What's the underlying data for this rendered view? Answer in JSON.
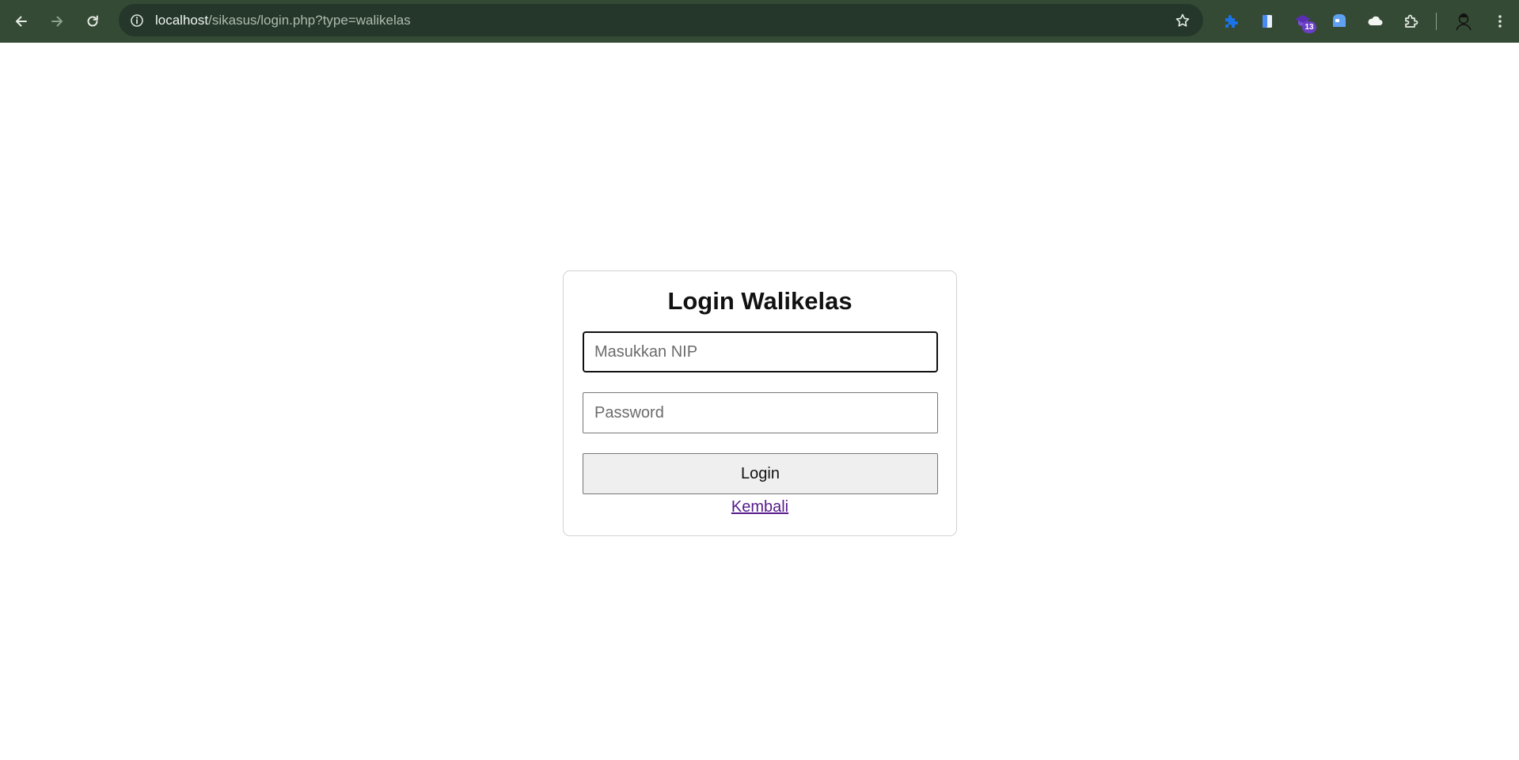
{
  "browser": {
    "url_host": "localhost",
    "url_path": "/sikasus/login.php?type=walikelas",
    "toolbar_color": "#354a35",
    "nav": {
      "back_icon": "back-arrow-icon",
      "forward_icon": "forward-arrow-icon",
      "reload_icon": "reload-icon"
    },
    "extensions": [
      {
        "name": "puzzle-extension-icon"
      },
      {
        "name": "document-extension-icon"
      },
      {
        "name": "graduation-cap-extension-icon",
        "badge": "13"
      },
      {
        "name": "translate-extension-icon"
      },
      {
        "name": "cloud-extension-icon"
      },
      {
        "name": "extensions-icon"
      }
    ]
  },
  "login": {
    "title": "Login Walikelas",
    "nip_placeholder": "Masukkan NIP",
    "password_placeholder": "Password",
    "submit_label": "Login",
    "back_link": "Kembali"
  }
}
